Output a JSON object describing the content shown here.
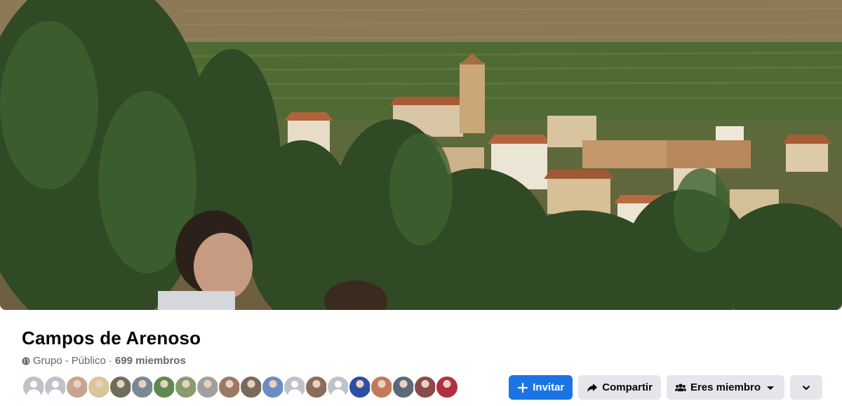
{
  "group": {
    "title": "Campos de Arenoso",
    "type_label": "Grupo",
    "separator": "·",
    "privacy": "Público",
    "members_count": "699 miembros"
  },
  "cover": {
    "icon": "cover-photo"
  },
  "member_avatars": [
    {
      "kind": "default",
      "color": "#bec3c9"
    },
    {
      "kind": "default",
      "color": "#bec3c9"
    },
    {
      "kind": "photo",
      "color": "#c9a58f"
    },
    {
      "kind": "photo",
      "color": "#d8c59a"
    },
    {
      "kind": "photo",
      "color": "#6d6d5a"
    },
    {
      "kind": "photo",
      "color": "#7b8794"
    },
    {
      "kind": "photo",
      "color": "#5f8a4f"
    },
    {
      "kind": "photo",
      "color": "#8a9a70"
    },
    {
      "kind": "photo",
      "color": "#a0a0a0"
    },
    {
      "kind": "photo",
      "color": "#9a7a66"
    },
    {
      "kind": "photo",
      "color": "#7a6a5a"
    },
    {
      "kind": "photo",
      "color": "#6b8cc4"
    },
    {
      "kind": "default",
      "color": "#bec3c9"
    },
    {
      "kind": "photo",
      "color": "#8a6d5a"
    },
    {
      "kind": "default",
      "color": "#bec3c9"
    },
    {
      "kind": "photo",
      "color": "#2d4fa0"
    },
    {
      "kind": "photo",
      "color": "#c47a5a"
    },
    {
      "kind": "photo",
      "color": "#5a6a7a"
    },
    {
      "kind": "photo",
      "color": "#8a4a4a"
    },
    {
      "kind": "photo",
      "color": "#b03040"
    }
  ],
  "actions": {
    "invite_label": "Invitar",
    "share_label": "Compartir",
    "member_label": "Eres miembro",
    "invite_icon": "plus-icon",
    "share_icon": "share-arrow-icon",
    "member_icon": "people-icon",
    "more_icon": "chevron-down-icon"
  },
  "colors": {
    "primary": "#1b74e4",
    "secondary_button": "#e4e6eb",
    "meta_text": "#65676b"
  }
}
